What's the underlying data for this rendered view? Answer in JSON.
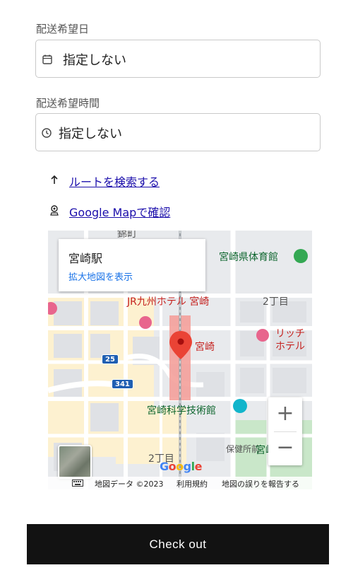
{
  "delivery_date": {
    "label": "配送希望日",
    "value": "指定しない",
    "icon": "calendar-icon"
  },
  "delivery_time": {
    "label": "配送希望時間",
    "value": "指定しない",
    "icon": "clock-icon"
  },
  "links": {
    "route": {
      "text": "ルートを検索する",
      "icon": "arrow-up-icon"
    },
    "google_map": {
      "text": "Google Mapで確認",
      "icon": "map-pin-icon"
    }
  },
  "map": {
    "place_card": {
      "title": "宮崎駅",
      "link": "拡大地図を表示"
    },
    "labels": {
      "gym": "宮崎県体育館",
      "hotel": "JR九州ホテル 宮崎",
      "chome2_top": "2丁目",
      "hotel2_line1": "リッチ",
      "hotel2_line2": "ホテル",
      "station": "宮崎",
      "museum": "宮崎科学技術館",
      "chome2_bottom": "2丁目",
      "hoken": "保健所前",
      "park": "宮崎",
      "top_road": "錦町",
      "route_25": "25",
      "route_341": "341"
    },
    "google_logo": "Google",
    "attribution": {
      "data": "地図データ ©2023",
      "terms": "利用規約",
      "report": "地図の誤りを報告する"
    },
    "zoom_in": "+",
    "zoom_out": "−",
    "colors": {
      "road": "#ffffff",
      "block": "#e8eaed",
      "park": "#c9e7c9",
      "commercial": "#fdf1d0",
      "station_highlight": "#f4a09a",
      "marker": "#ea4335"
    }
  },
  "checkout": {
    "label": "Check out"
  }
}
